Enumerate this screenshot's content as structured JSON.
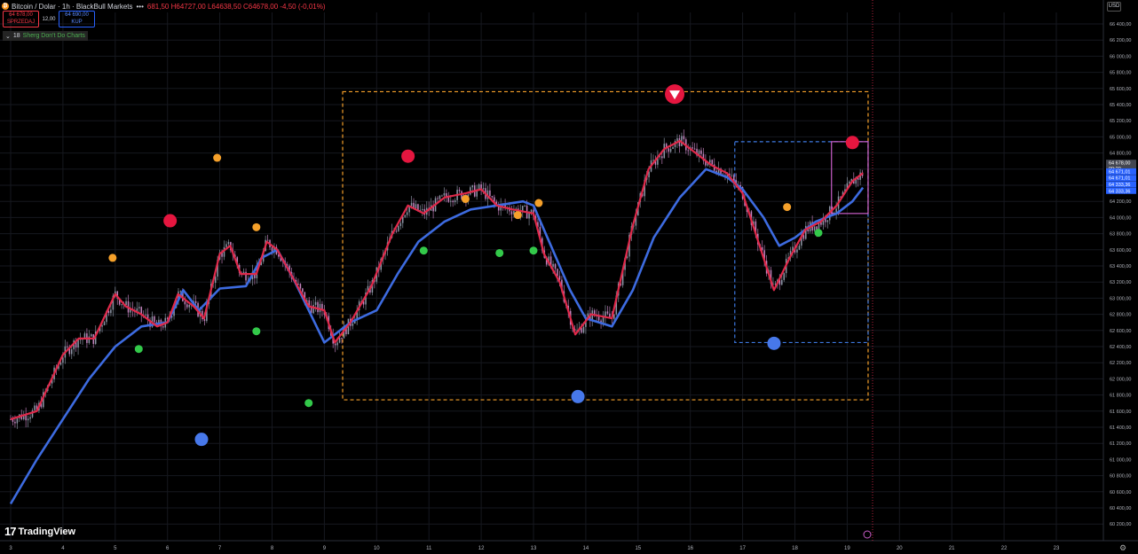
{
  "header": {
    "coin_icon": "bitcoin-icon",
    "title": "Bitcoin / Dolar · 1h · BlackBull Markets",
    "dots": "•••",
    "ohlc": "681,50  H64727,00  L64638,50  C64678,00  -4,50 (-0,01%)"
  },
  "trade": {
    "sell_price": "64 678,00",
    "sell_label": "SPRZEDAJ",
    "spread": "12,00",
    "buy_price": "64 690,00",
    "buy_label": "KUP"
  },
  "indicator": {
    "chevron": "⌄",
    "count": "18",
    "name": "Sherg Don't Do Charts"
  },
  "currency": "USD",
  "logo": {
    "mark": "17",
    "name": "TradingView"
  },
  "settings_icon": "gear-icon",
  "colors": {
    "background": "#000000",
    "bull_candle": "#9aa4b5",
    "bear_candle": "#d68fd0",
    "fast_line": "#e0294a",
    "slow_line": "#3d6be0",
    "orange_dot": "#f5a02a",
    "green_dot": "#33c94a",
    "red_dot": "#e5163f",
    "blue_dot": "#4778ea",
    "orange_box": "#f5a02a",
    "blue_box": "#3d78e0",
    "magenta_box": "#c95ec9"
  },
  "chart_data": {
    "type": "line",
    "ylim": [
      60100,
      66600
    ],
    "x_axis_ticks": [
      "3",
      "4",
      "5",
      "6",
      "7",
      "8",
      "9",
      "10",
      "11",
      "12",
      "13",
      "14",
      "15",
      "16",
      "17",
      "18",
      "19",
      "20",
      "21",
      "22",
      "23"
    ],
    "y_axis_ticks": [
      "66 400,00",
      "66 200,00",
      "66 000,00",
      "65 800,00",
      "65 600,00",
      "65 400,00",
      "65 200,00",
      "65 000,00",
      "64 800,00",
      "64 600,00",
      "64 400,00",
      "64 200,00",
      "64 000,00",
      "63 800,00",
      "63 600,00",
      "63 400,00",
      "63 200,00",
      "63 000,00",
      "62 800,00",
      "62 600,00",
      "62 400,00",
      "62 200,00",
      "62 000,00",
      "61 800,00",
      "61 600,00",
      "61 400,00",
      "61 200,00",
      "61 000,00",
      "60 800,00",
      "60 600,00",
      "60 400,00",
      "60 200,00"
    ],
    "price_labels": [
      {
        "value": 64678,
        "text": "64 678,00",
        "sub": "09:20",
        "kind": "last"
      },
      {
        "value": 64571,
        "text": "64 671,01",
        "kind": "line"
      },
      {
        "value": 64491,
        "text": "64 671,01",
        "kind": "line"
      },
      {
        "value": 64411,
        "text": "64 333,36",
        "kind": "line"
      },
      {
        "value": 64331,
        "text": "64 333,36",
        "kind": "line"
      }
    ],
    "series": [
      {
        "role": "fast",
        "points": [
          [
            3.0,
            61500
          ],
          [
            3.5,
            61600
          ],
          [
            4.0,
            62300
          ],
          [
            4.3,
            62500
          ],
          [
            4.6,
            62500
          ],
          [
            5.0,
            63050
          ],
          [
            5.2,
            62900
          ],
          [
            5.5,
            62800
          ],
          [
            5.8,
            62650
          ],
          [
            6.0,
            62700
          ],
          [
            6.2,
            63050
          ],
          [
            6.5,
            62900
          ],
          [
            6.7,
            62750
          ],
          [
            7.0,
            63550
          ],
          [
            7.2,
            63650
          ],
          [
            7.4,
            63300
          ],
          [
            7.7,
            63300
          ],
          [
            7.9,
            63700
          ],
          [
            8.1,
            63600
          ],
          [
            8.4,
            63250
          ],
          [
            8.7,
            62900
          ],
          [
            9.0,
            62850
          ],
          [
            9.2,
            62450
          ],
          [
            9.5,
            62700
          ],
          [
            9.9,
            63150
          ],
          [
            10.3,
            63800
          ],
          [
            10.6,
            64150
          ],
          [
            10.9,
            64050
          ],
          [
            11.3,
            64250
          ],
          [
            11.7,
            64300
          ],
          [
            12.0,
            64350
          ],
          [
            12.3,
            64150
          ],
          [
            12.6,
            64100
          ],
          [
            13.0,
            64050
          ],
          [
            13.2,
            63550
          ],
          [
            13.5,
            63200
          ],
          [
            13.8,
            62550
          ],
          [
            14.1,
            62800
          ],
          [
            14.5,
            62750
          ],
          [
            14.9,
            63900
          ],
          [
            15.2,
            64600
          ],
          [
            15.5,
            64850
          ],
          [
            15.8,
            64950
          ],
          [
            16.0,
            64850
          ],
          [
            16.4,
            64650
          ],
          [
            16.7,
            64550
          ],
          [
            17.0,
            64300
          ],
          [
            17.3,
            63700
          ],
          [
            17.6,
            63100
          ],
          [
            17.9,
            63500
          ],
          [
            18.2,
            63850
          ],
          [
            18.5,
            63950
          ],
          [
            18.8,
            64150
          ],
          [
            19.1,
            64450
          ],
          [
            19.3,
            64550
          ]
        ]
      },
      {
        "role": "slow",
        "points": [
          [
            3.0,
            60450
          ],
          [
            3.5,
            61000
          ],
          [
            4.0,
            61500
          ],
          [
            4.5,
            62000
          ],
          [
            5.0,
            62400
          ],
          [
            5.5,
            62650
          ],
          [
            6.0,
            62700
          ],
          [
            6.3,
            63100
          ],
          [
            6.6,
            62850
          ],
          [
            7.0,
            63120
          ],
          [
            7.5,
            63150
          ],
          [
            7.8,
            63500
          ],
          [
            8.1,
            63600
          ],
          [
            8.4,
            63250
          ],
          [
            9.0,
            62450
          ],
          [
            9.5,
            62700
          ],
          [
            10.0,
            62850
          ],
          [
            10.4,
            63300
          ],
          [
            10.8,
            63700
          ],
          [
            11.3,
            63950
          ],
          [
            11.8,
            64100
          ],
          [
            12.3,
            64150
          ],
          [
            12.8,
            64200
          ],
          [
            13.0,
            64150
          ],
          [
            13.3,
            63700
          ],
          [
            13.7,
            63100
          ],
          [
            14.0,
            62750
          ],
          [
            14.5,
            62650
          ],
          [
            14.9,
            63100
          ],
          [
            15.3,
            63750
          ],
          [
            15.8,
            64250
          ],
          [
            16.3,
            64600
          ],
          [
            16.7,
            64500
          ],
          [
            17.0,
            64350
          ],
          [
            17.4,
            64000
          ],
          [
            17.7,
            63650
          ],
          [
            18.0,
            63750
          ],
          [
            18.4,
            63950
          ],
          [
            18.8,
            64050
          ],
          [
            19.1,
            64200
          ],
          [
            19.3,
            64370
          ]
        ]
      }
    ],
    "markers": [
      {
        "x": 4.95,
        "y": 63500,
        "type": "orange"
      },
      {
        "x": 5.45,
        "y": 62370,
        "type": "green"
      },
      {
        "x": 6.05,
        "y": 63960,
        "type": "red"
      },
      {
        "x": 6.65,
        "y": 61250,
        "type": "blue"
      },
      {
        "x": 6.95,
        "y": 64740,
        "type": "orange"
      },
      {
        "x": 7.7,
        "y": 63880,
        "type": "orange"
      },
      {
        "x": 7.7,
        "y": 62590,
        "type": "green"
      },
      {
        "x": 8.7,
        "y": 61700,
        "type": "green"
      },
      {
        "x": 10.6,
        "y": 64760,
        "type": "red"
      },
      {
        "x": 10.9,
        "y": 63590,
        "type": "green"
      },
      {
        "x": 11.7,
        "y": 64230,
        "type": "orange"
      },
      {
        "x": 12.35,
        "y": 63560,
        "type": "green"
      },
      {
        "x": 12.7,
        "y": 64030,
        "type": "orange"
      },
      {
        "x": 13.0,
        "y": 63590,
        "type": "green"
      },
      {
        "x": 13.1,
        "y": 64180,
        "type": "orange"
      },
      {
        "x": 13.85,
        "y": 61780,
        "type": "blue"
      },
      {
        "x": 15.7,
        "y": 65530,
        "type": "arrow-down"
      },
      {
        "x": 17.6,
        "y": 62440,
        "type": "blue"
      },
      {
        "x": 17.85,
        "y": 64130,
        "type": "orange"
      },
      {
        "x": 18.45,
        "y": 63810,
        "type": "green"
      },
      {
        "x": 19.1,
        "y": 64930,
        "type": "red"
      }
    ],
    "boxes": [
      {
        "x0": 9.35,
        "x1": 19.4,
        "y0": 61740,
        "y1": 65560,
        "type": "orange"
      },
      {
        "x0": 16.85,
        "x1": 19.4,
        "y0": 62450,
        "y1": 64940,
        "type": "blue"
      },
      {
        "x0": 18.7,
        "x1": 19.4,
        "y0": 64050,
        "y1": 64940,
        "type": "magenta"
      }
    ]
  }
}
